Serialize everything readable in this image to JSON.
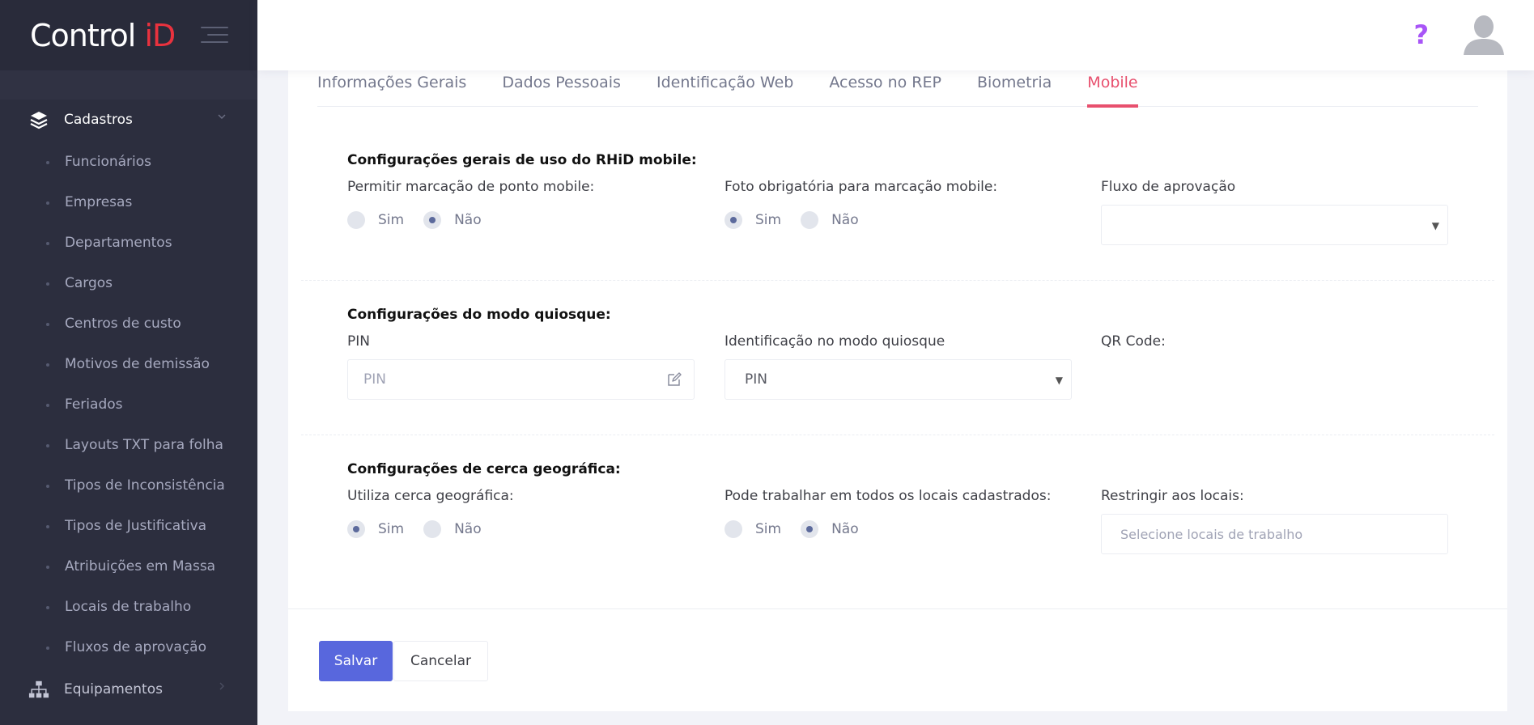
{
  "brand": {
    "name_part1": "Control ",
    "name_part2": "iD",
    "accent_color": "#e8323e"
  },
  "sidebar": {
    "section_cadastros": {
      "label": "Cadastros",
      "icon": "layers-icon"
    },
    "items": [
      {
        "label": "Funcionários"
      },
      {
        "label": "Empresas"
      },
      {
        "label": "Departamentos"
      },
      {
        "label": "Cargos"
      },
      {
        "label": "Centros de custo"
      },
      {
        "label": "Motivos de demissão"
      },
      {
        "label": "Feriados"
      },
      {
        "label": "Layouts TXT para folha"
      },
      {
        "label": "Tipos de Inconsistência"
      },
      {
        "label": "Tipos de Justificativa"
      },
      {
        "label": "Atribuições em Massa"
      },
      {
        "label": "Locais de trabalho"
      },
      {
        "label": "Fluxos de aprovação"
      }
    ],
    "section_equipamentos": {
      "label": "Equipamentos",
      "icon": "sitemap-icon"
    }
  },
  "topbar": {
    "help_symbol": "?",
    "help_color": "#a855f7"
  },
  "tabs": [
    {
      "label": "Informações Gerais",
      "active": false
    },
    {
      "label": "Dados Pessoais",
      "active": false
    },
    {
      "label": "Identificação Web",
      "active": false
    },
    {
      "label": "Acesso no REP",
      "active": false
    },
    {
      "label": "Biometria",
      "active": false
    },
    {
      "label": "Mobile",
      "active": true
    }
  ],
  "mobile_general": {
    "title": "Configurações gerais de uso do RHiD mobile:",
    "allow_mobile": {
      "label": "Permitir marcação de ponto mobile:",
      "yes": "Sim",
      "no": "Não",
      "selected": "no"
    },
    "photo_required": {
      "label": "Foto obrigatória para marcação mobile:",
      "yes": "Sim",
      "no": "Não",
      "selected": "yes"
    },
    "approval_flow": {
      "label": "Fluxo de aprovação",
      "value": ""
    }
  },
  "kiosk": {
    "title": "Configurações do modo quiosque:",
    "pin": {
      "label": "PIN",
      "placeholder": "PIN"
    },
    "identification": {
      "label": "Identificação no modo quiosque",
      "value": "PIN"
    },
    "qr": {
      "label": "QR Code:"
    }
  },
  "geofence": {
    "title": "Configurações de cerca geográfica:",
    "uses_geofence": {
      "label": "Utiliza cerca geográfica:",
      "yes": "Sim",
      "no": "Não",
      "selected": "yes"
    },
    "all_locations": {
      "label": "Pode trabalhar em todos os locais cadastrados:",
      "yes": "Sim",
      "no": "Não",
      "selected": "no"
    },
    "restrict": {
      "label": "Restringir aos locais:",
      "placeholder": "Selecione locais de trabalho"
    }
  },
  "actions": {
    "save": "Salvar",
    "cancel": "Cancelar",
    "primary_color": "#5867dd"
  }
}
